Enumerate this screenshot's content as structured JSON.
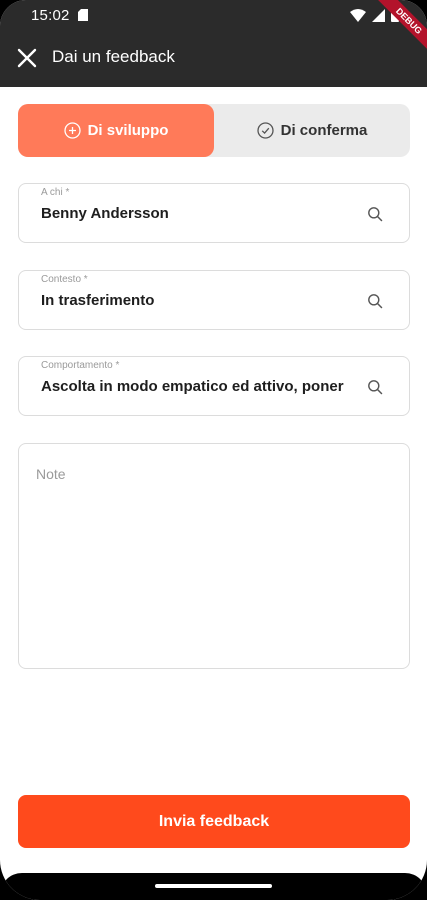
{
  "status_bar": {
    "time": "15:02",
    "icons": [
      "sd-card-icon",
      "wifi-icon",
      "signal-icon",
      "battery-icon"
    ]
  },
  "app_bar": {
    "title": "Dai un feedback",
    "debug_banner": "DEBUG"
  },
  "segment": {
    "options": [
      {
        "label": "Di sviluppo",
        "icon": "plus-circle-icon",
        "selected": true
      },
      {
        "label": "Di conferma",
        "icon": "check-circle-icon",
        "selected": false
      }
    ]
  },
  "form": {
    "recipient": {
      "label": "A chi *",
      "value": "Benny Andersson"
    },
    "context": {
      "label": "Contesto *",
      "value": "In trasferimento"
    },
    "behaviour": {
      "label": "Comportamento *",
      "value": "Ascolta in modo empatico ed attivo, poner"
    },
    "note": {
      "placeholder": "Note"
    }
  },
  "submit_label": "Invia feedback",
  "colors": {
    "app_bar": "#2b2b2b",
    "selected_segment": "#ff7a59",
    "primary_button": "#ff4a1c"
  }
}
